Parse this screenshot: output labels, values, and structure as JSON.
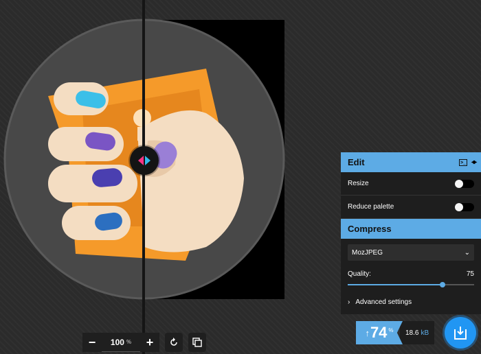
{
  "toolbar": {
    "zoom_out_label": "−",
    "zoom_value": "100",
    "zoom_unit": "%",
    "zoom_in_label": "+",
    "rotate_icon": "rotate-icon",
    "background_toggle_icon": "background-toggle-icon"
  },
  "edit": {
    "title": "Edit",
    "icons": [
      "terminal-icon",
      "split-view-icon"
    ],
    "resize_label": "Resize",
    "reduce_palette_label": "Reduce palette"
  },
  "compress": {
    "title": "Compress",
    "codec_selected": "MozJPEG",
    "quality_label": "Quality:",
    "quality_value": "75",
    "quality_fraction": 0.75,
    "advanced_label": "Advanced settings"
  },
  "result": {
    "arrow": "↑",
    "percent": "74",
    "percent_unit": "%",
    "size_value": "18.6",
    "size_unit": "kB"
  },
  "colors": {
    "accent": "#5dabe5",
    "download": "#2196f3",
    "handle_left": "#ff3385",
    "handle_right": "#34b9eb"
  }
}
